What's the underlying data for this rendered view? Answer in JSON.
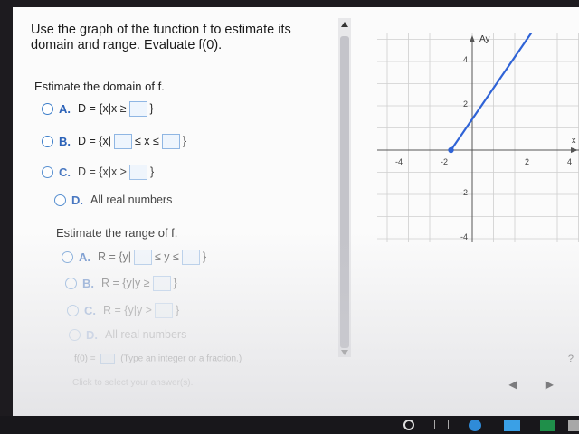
{
  "question": "Use the graph of the function f to estimate its domain and range. Evaluate f(0).",
  "domain_section": {
    "label": "Estimate the domain of f.",
    "options": [
      {
        "letter": "A.",
        "pre": "D = {x|x ≥",
        "post": "}"
      },
      {
        "letter": "B.",
        "pre": "D = {x|",
        "mid": "≤ x ≤",
        "post": "}"
      },
      {
        "letter": "C.",
        "pre": "D = {x|x >",
        "post": "}"
      },
      {
        "letter": "D.",
        "text": "All real numbers"
      }
    ]
  },
  "range_section": {
    "label": "Estimate the range of f.",
    "options": [
      {
        "letter": "A.",
        "pre": "R = {y|",
        "mid": "≤ y ≤",
        "post": "}"
      },
      {
        "letter": "B.",
        "pre": "R = {y|y ≥",
        "post": "}"
      },
      {
        "letter": "C.",
        "pre": "R = {y|y >",
        "post": "}"
      },
      {
        "letter": "D.",
        "text": "All real numbers"
      }
    ]
  },
  "f0": {
    "label": "f(0) =",
    "hint": "(Type an integer or a fraction.)"
  },
  "footer": "Click to select your answer(s).",
  "help": "?",
  "nav": "◀ ▶",
  "graph": {
    "y_axis_label": "Ay",
    "x_axis_label": "x",
    "x_ticks": [
      "-4",
      "-2",
      "2",
      "4"
    ],
    "y_ticks": [
      "4",
      "2",
      "-2",
      "-4"
    ],
    "closed_point": [
      -1,
      0
    ],
    "arrow_end": [
      4,
      7
    ],
    "line_color": "#2f63d6"
  }
}
